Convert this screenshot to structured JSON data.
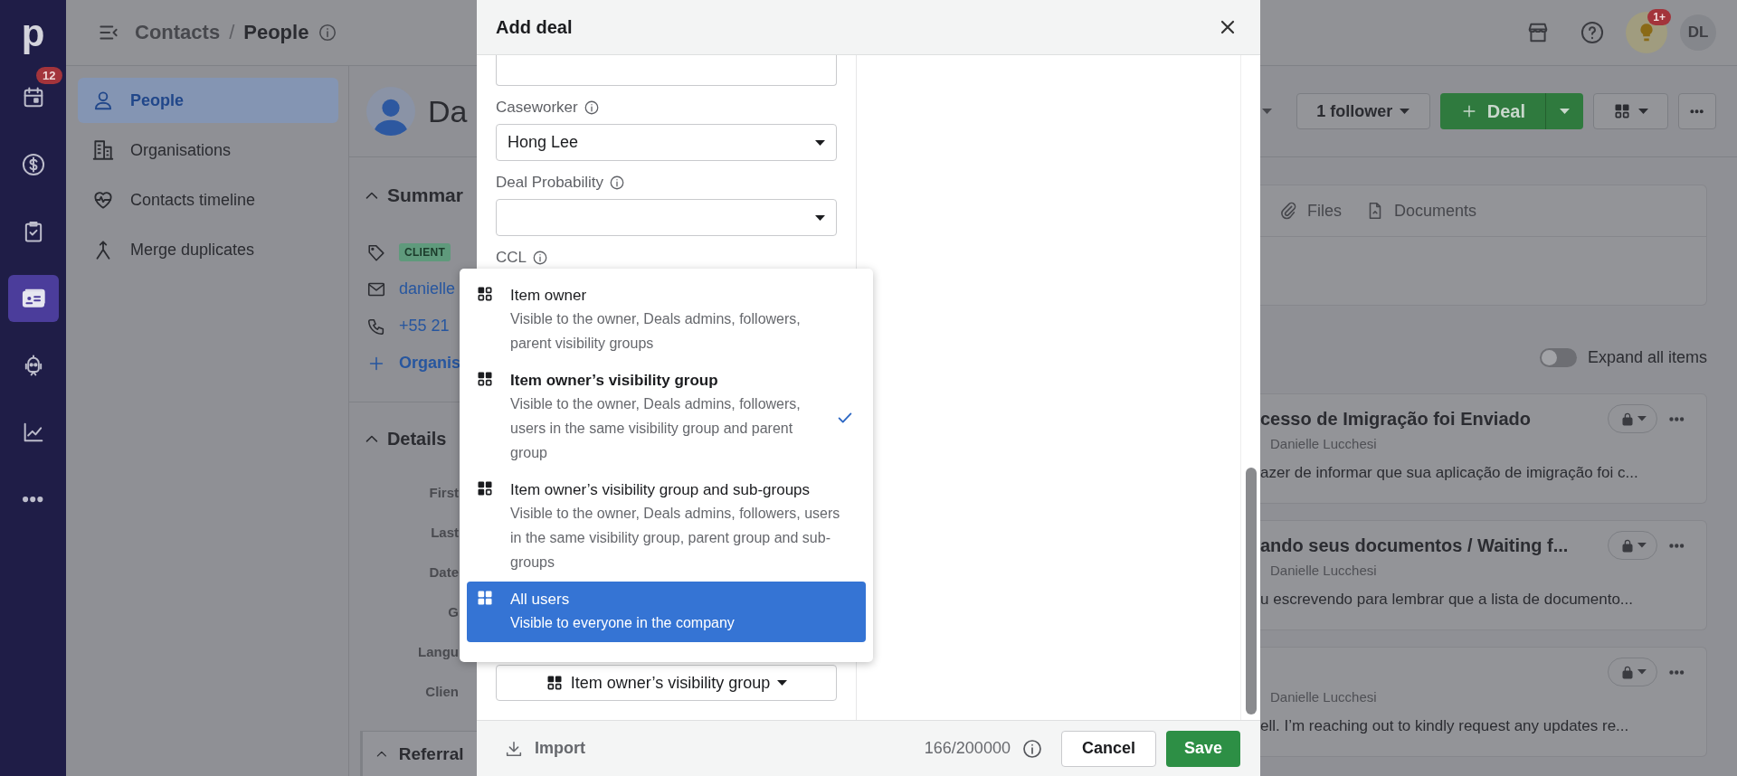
{
  "nav_rail": {
    "logo": "p",
    "items": [
      {
        "badge": "12",
        "selected": false
      },
      {
        "selected": false
      },
      {
        "selected": false
      },
      {
        "selected": true
      },
      {
        "selected": false
      },
      {
        "selected": false
      },
      {
        "selected": false
      }
    ]
  },
  "top_bar": {
    "breadcrumb": [
      "Contacts",
      "People"
    ],
    "separator": "/",
    "notification_badge": "1+",
    "avatar": "DL"
  },
  "sidebar": {
    "items": [
      {
        "label": "People",
        "selected": true
      },
      {
        "label": "Organisations",
        "selected": false
      },
      {
        "label": "Contacts timeline",
        "selected": false
      },
      {
        "label": "Merge duplicates",
        "selected": false
      }
    ]
  },
  "person": {
    "name": "Da",
    "summary": {
      "title": "Summar",
      "tag": "CLIENT",
      "email": "danielle",
      "phone": "+55 21",
      "add_organisation": "Organis"
    },
    "details": {
      "title": "Details",
      "fields": [
        "First",
        "Last",
        "Date",
        "G",
        "Langu",
        "Clien"
      ]
    },
    "referrals": "Referral"
  },
  "actions": {
    "followers": "1 follower",
    "add_deal": "Deal"
  },
  "tabs": [
    {
      "label": "Files",
      "selected": false
    },
    {
      "label": "Documents",
      "selected": false
    }
  ],
  "expand_all": {
    "label": "Expand all items",
    "on": false
  },
  "timeline": [
    {
      "title": "cesso de Imigração foi Enviado",
      "author": "Danielle Lucchesi",
      "excerpt": "azer de informar que sua aplicação de imigração foi c..."
    },
    {
      "title": "ando seus documentos / Waiting f...",
      "author": "Danielle Lucchesi",
      "excerpt": "u escrevendo para lembrar que a lista de documento..."
    },
    {
      "author": "Danielle Lucchesi",
      "excerpt": "ell. I’m reaching out to kindly request any updates re..."
    }
  ],
  "dialog": {
    "title": "Add deal",
    "fields": [
      {
        "label": "Caseworker",
        "value": "Hong Lee"
      },
      {
        "label": "Deal Probability"
      },
      {
        "label": "CCL"
      }
    ],
    "visibility_menu": {
      "options": [
        {
          "title": "Item owner",
          "description": "Visible to the owner, Deals admins, followers, parent visibility groups",
          "selected": false,
          "highlighted": false
        },
        {
          "title": "Item owner’s visibility group",
          "description": "Visible to the owner, Deals admins, followers, users in the same visibility group and parent group",
          "selected": true,
          "highlighted": false
        },
        {
          "title": "Item owner’s visibility group and sub-groups",
          "description": "Visible to the owner, Deals admins, followers, users in the same visibility group, parent group and sub-groups",
          "selected": false,
          "highlighted": false
        },
        {
          "title": "All users",
          "description": "Visible to everyone in the company",
          "selected": false,
          "highlighted": true
        }
      ]
    },
    "visibility_button": "Item owner’s visibility group",
    "import": "Import",
    "char_count": "166/200000",
    "cancel": "Cancel",
    "save": "Save"
  }
}
